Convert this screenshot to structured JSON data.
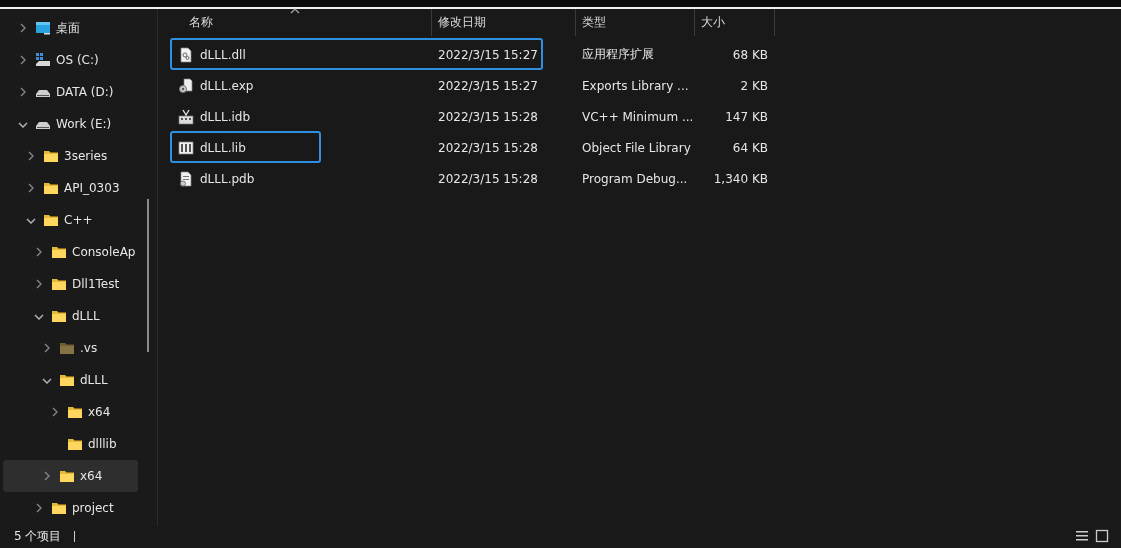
{
  "sidebar": {
    "tree": [
      {
        "label": "桌面",
        "kind": "desktop",
        "has_children": true,
        "expanded": false,
        "selected": false
      },
      {
        "label": "OS (C:)",
        "kind": "system-drive",
        "has_children": true,
        "expanded": false,
        "selected": false
      },
      {
        "label": "DATA (D:)",
        "kind": "drive",
        "has_children": true,
        "expanded": false,
        "selected": false
      },
      {
        "label": "Work (E:)",
        "kind": "drive",
        "has_children": true,
        "expanded": true,
        "selected": false,
        "children": [
          {
            "label": "3series",
            "kind": "folder",
            "has_children": true,
            "expanded": false,
            "selected": false
          },
          {
            "label": "API_0303",
            "kind": "folder",
            "has_children": true,
            "expanded": false,
            "selected": false
          },
          {
            "label": "C++",
            "kind": "folder",
            "has_children": true,
            "expanded": true,
            "selected": false,
            "children": [
              {
                "label": "ConsoleAp",
                "kind": "folder",
                "has_children": true,
                "expanded": false,
                "selected": false
              },
              {
                "label": "Dll1Test",
                "kind": "folder",
                "has_children": true,
                "expanded": false,
                "selected": false
              },
              {
                "label": "dLLL",
                "kind": "folder",
                "has_children": true,
                "expanded": true,
                "selected": false,
                "children": [
                  {
                    "label": ".vs",
                    "kind": "hidden-folder",
                    "has_children": true,
                    "expanded": false,
                    "selected": false
                  },
                  {
                    "label": "dLLL",
                    "kind": "folder",
                    "has_children": true,
                    "expanded": true,
                    "selected": false,
                    "children": [
                      {
                        "label": "x64",
                        "kind": "folder",
                        "has_children": true,
                        "expanded": false,
                        "selected": false
                      },
                      {
                        "label": "dlllib",
                        "kind": "folder",
                        "has_children": false,
                        "expanded": false,
                        "selected": false
                      }
                    ]
                  },
                  {
                    "label": "x64",
                    "kind": "folder",
                    "has_children": true,
                    "expanded": false,
                    "selected": true
                  }
                ]
              },
              {
                "label": "project",
                "kind": "folder",
                "has_children": true,
                "expanded": false,
                "selected": false
              }
            ]
          }
        ]
      }
    ]
  },
  "table": {
    "columns": [
      {
        "label": "名称",
        "sorted": true
      },
      {
        "label": "修改日期",
        "sorted": false
      },
      {
        "label": "类型",
        "sorted": false
      },
      {
        "label": "大小",
        "sorted": false
      }
    ],
    "rows": [
      {
        "name": "dLLL.dll",
        "kind": "dll",
        "modified": "2022/3/15 15:27",
        "type": "应用程序扩展",
        "size": "68 KB",
        "name_highlighted": true,
        "date_highlighted": true
      },
      {
        "name": "dLLL.exp",
        "kind": "exp",
        "modified": "2022/3/15 15:27",
        "type": "Exports Library ...",
        "size": "2 KB",
        "name_highlighted": false,
        "date_highlighted": false
      },
      {
        "name": "dLLL.idb",
        "kind": "idb",
        "modified": "2022/3/15 15:28",
        "type": "VC++ Minimum ...",
        "size": "147 KB",
        "name_highlighted": false,
        "date_highlighted": false
      },
      {
        "name": "dLLL.lib",
        "kind": "lib",
        "modified": "2022/3/15 15:28",
        "type": "Object File Library",
        "size": "64 KB",
        "name_highlighted": true,
        "date_highlighted": false
      },
      {
        "name": "dLLL.pdb",
        "kind": "pdb",
        "modified": "2022/3/15 15:28",
        "type": "Program Debug...",
        "size": "1,340 KB",
        "name_highlighted": false,
        "date_highlighted": false
      }
    ]
  },
  "status_bar": {
    "item_count": "5 个项目"
  }
}
